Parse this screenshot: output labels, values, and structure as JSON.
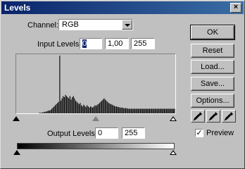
{
  "window": {
    "title": "Levels",
    "close_glyph": "×"
  },
  "channel": {
    "label": "Channel:",
    "value": "RGB"
  },
  "input_levels": {
    "label": "Input Levels:",
    "black": "0",
    "gamma": "1,00",
    "white": "255"
  },
  "output_levels": {
    "label": "Output Levels:",
    "black": "0",
    "white": "255"
  },
  "buttons": {
    "ok": "OK",
    "reset": "Reset",
    "load": "Load...",
    "save": "Save...",
    "options": "Options..."
  },
  "eyedroppers": [
    "black-point-eyedropper-icon",
    "gray-point-eyedropper-icon",
    "white-point-eyedropper-icon"
  ],
  "preview": {
    "label": "Preview",
    "checked": true
  },
  "colors": {
    "titlebar_start": "#0a246a",
    "titlebar_end": "#3a6ea5",
    "face": "#c0c0c0"
  },
  "histogram": [
    0,
    0,
    0,
    0,
    0,
    0,
    0,
    0,
    0,
    0,
    0,
    0,
    0,
    0,
    0,
    0,
    0,
    0,
    0,
    0,
    1,
    1,
    1,
    2,
    2,
    3,
    3,
    4,
    5,
    5,
    6,
    8,
    10,
    12,
    14,
    16,
    18,
    20,
    100,
    22,
    26,
    30,
    28,
    32,
    30,
    28,
    26,
    30,
    24,
    28,
    30,
    26,
    22,
    20,
    18,
    16,
    18,
    14,
    12,
    15,
    13,
    11,
    14,
    12,
    10,
    12,
    11,
    10,
    12,
    14,
    13,
    15,
    16,
    18,
    20,
    22,
    24,
    26,
    24,
    22,
    20,
    18,
    17,
    16,
    15,
    14,
    13,
    12,
    12,
    11,
    11,
    10,
    10,
    10,
    9,
    9,
    9,
    9,
    8,
    8,
    8,
    8,
    8,
    8,
    8,
    8,
    8,
    8,
    8,
    8,
    8,
    8,
    8,
    8,
    8,
    8,
    8,
    8,
    8,
    8,
    8,
    8,
    8,
    8,
    8,
    8,
    8,
    8,
    8,
    8,
    8,
    8,
    8,
    8,
    8,
    8,
    8,
    8,
    8,
    8
  ]
}
